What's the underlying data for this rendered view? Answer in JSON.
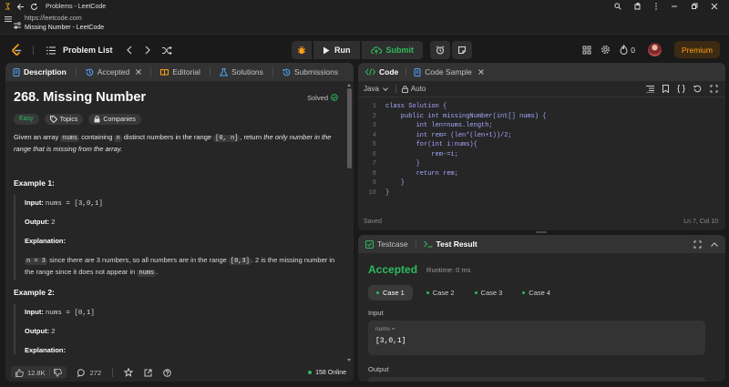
{
  "browser": {
    "window_title": "Problems - LeetCode",
    "url": "https://leetcode.com",
    "page_title": "Missing Number - LeetCode"
  },
  "nav": {
    "problem_list": "Problem List",
    "run": "Run",
    "submit": "Submit",
    "streak": "0",
    "premium": "Premium"
  },
  "left_tabs": [
    "Description",
    "Accepted",
    "Editorial",
    "Solutions",
    "Submissions"
  ],
  "problem": {
    "title": "268. Missing Number",
    "status": "Solved",
    "difficulty": "Easy",
    "topics": "Topics",
    "companies": "Companies",
    "desc_1": "Given an array ",
    "desc_nums": "nums",
    "desc_2": " containing ",
    "desc_n": "n",
    "desc_3": " distinct numbers in the range ",
    "desc_range": "[0, n]",
    "desc_4": ", return ",
    "desc_italic": "the only number in the range that is missing from the array.",
    "example1_title": "Example 1:",
    "example1_input_label": "Input:",
    "example1_input": "nums = [3,0,1]",
    "example1_output_label": "Output:",
    "example1_output": "2",
    "explanation_label": "Explanation:",
    "expl_n3": "n = 3",
    "expl_1": " since there are 3 numbers, so all numbers are in the range ",
    "expl_range": "[0,3]",
    "expl_2": ". 2 is the missing number in the range since it does not appear in ",
    "expl_nums": "nums",
    "expl_3": ".",
    "example2_title": "Example 2:",
    "example2_input_label": "Input:",
    "example2_input": "nums = [0,1]",
    "example2_output_label": "Output:",
    "example2_output": "2",
    "example2_expl_label": "Explanation:"
  },
  "footer": {
    "likes": "12.8K",
    "comments": "272",
    "online": "158 Online"
  },
  "code_panel": {
    "tab_code": "Code",
    "tab_sample": "Code Sample",
    "language": "Java",
    "auto": "Auto",
    "saved": "Saved",
    "cursor": "Ln 7, Col 10",
    "lines": [
      "class Solution {",
      "    public int missingNumber(int[] nums) {",
      "        int len=nums.length;",
      "        int rem= (len*(len+1))/2;",
      "        for(int i:nums){",
      "            rem-=i;",
      "        }",
      "        return rem;",
      "    }",
      "}"
    ]
  },
  "result_panel": {
    "tab_testcase": "Testcase",
    "tab_result": "Test Result",
    "accepted": "Accepted",
    "runtime": "Runtime: 0 ms",
    "cases": [
      "Case 1",
      "Case 2",
      "Case 3",
      "Case 4"
    ],
    "input_label": "Input",
    "input_var": "nums =",
    "input_value": "[3,0,1]",
    "output_label": "Output"
  },
  "colors": {
    "accepted": "#2cbb5d",
    "premium": "#ffa116",
    "bg": "#1a1a1a",
    "panel": "#262626"
  }
}
